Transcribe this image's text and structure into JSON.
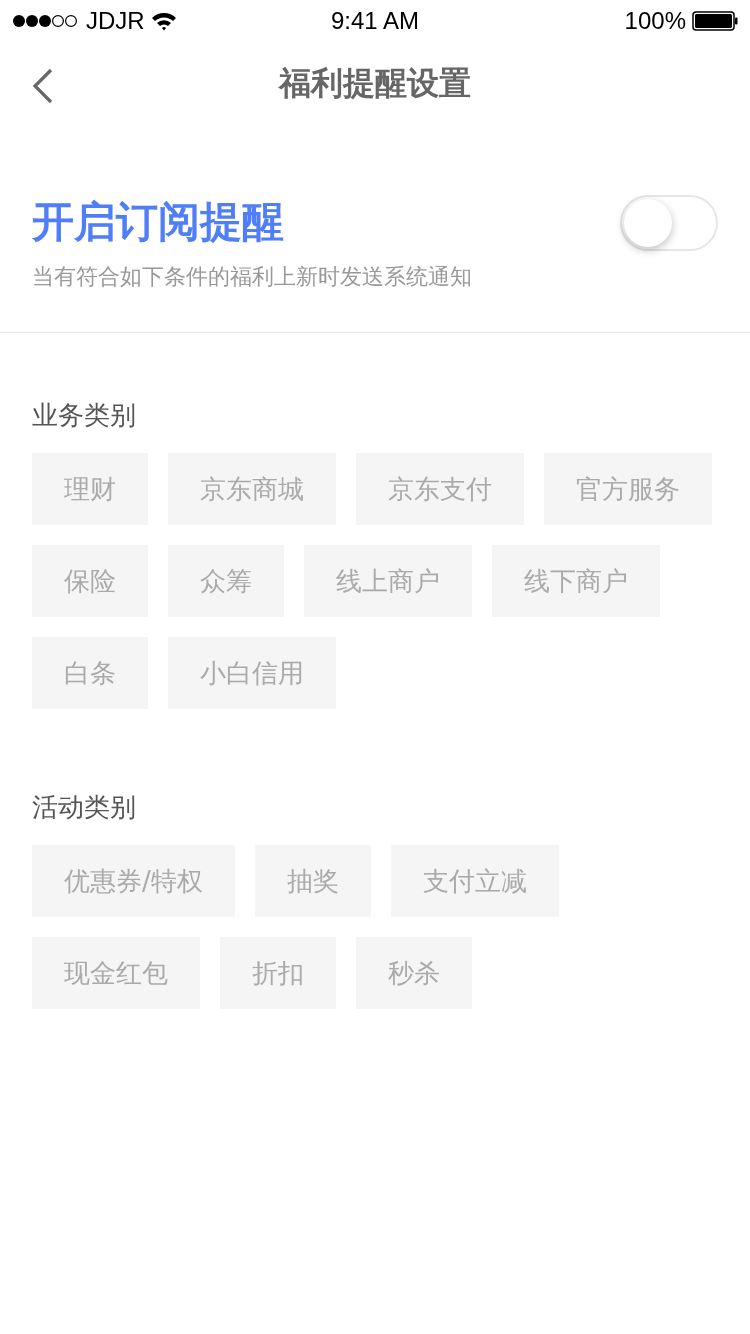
{
  "status_bar": {
    "carrier": "JDJR",
    "time": "9:41 AM",
    "battery": "100%"
  },
  "nav": {
    "title": "福利提醒设置"
  },
  "subscribe": {
    "title": "开启订阅提醒",
    "description": "当有符合如下条件的福利上新时发送系统通知",
    "on": false
  },
  "sections": [
    {
      "title": "业务类别",
      "tags": [
        {
          "label": "理财",
          "selected": false
        },
        {
          "label": "京东商城",
          "selected": false
        },
        {
          "label": "京东支付",
          "selected": false
        },
        {
          "label": "官方服务",
          "selected": false
        },
        {
          "label": "保险",
          "selected": false
        },
        {
          "label": "众筹",
          "selected": false
        },
        {
          "label": "线上商户",
          "selected": false
        },
        {
          "label": "线下商户",
          "selected": false
        },
        {
          "label": "白条",
          "selected": false
        },
        {
          "label": "小白信用",
          "selected": false
        }
      ]
    },
    {
      "title": "活动类别",
      "tags": [
        {
          "label": "优惠券/特权",
          "selected": false
        },
        {
          "label": "抽奖",
          "selected": false
        },
        {
          "label": "支付立减",
          "selected": false
        },
        {
          "label": "现金红包",
          "selected": false
        },
        {
          "label": "折扣",
          "selected": false
        },
        {
          "label": "秒杀",
          "selected": false
        }
      ]
    }
  ]
}
